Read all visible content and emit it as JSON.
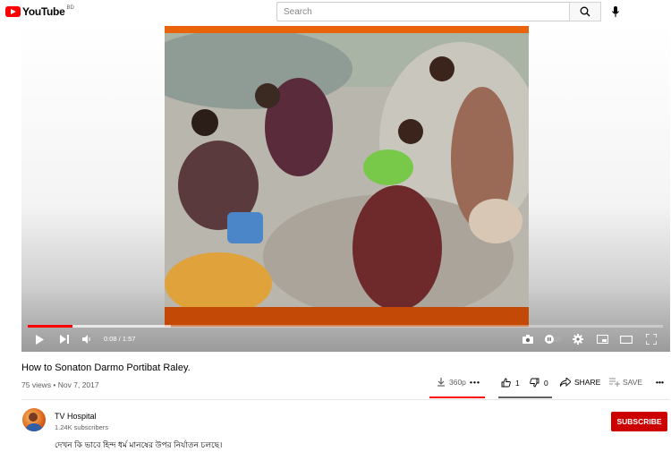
{
  "header": {
    "logo_text": "YouTube",
    "logo_country": "BD",
    "search_placeholder": "Search"
  },
  "player": {
    "time": "0:08 / 1:57",
    "progress_fraction": 0.07
  },
  "video": {
    "title": "How to Sonaton Darmo Portibat Raley.",
    "meta": "75 views • Nov 7, 2017",
    "quality": "360p",
    "likes": "1",
    "dislikes": "0",
    "share_label": "SHARE",
    "save_label": "SAVE"
  },
  "channel": {
    "name": "TV Hospital",
    "subscribers": "1.24K subscribers",
    "subscribe_label": "SUBSCRIBE"
  },
  "description": "দেখন কি ভাবে হিন্দ ধর্ম মানষের উপর নির্যাতন চলছে।",
  "colors": {
    "brand_red": "#ff0000",
    "subscribe_red": "#cc0000",
    "video_frame_orange": "#c24a06"
  }
}
